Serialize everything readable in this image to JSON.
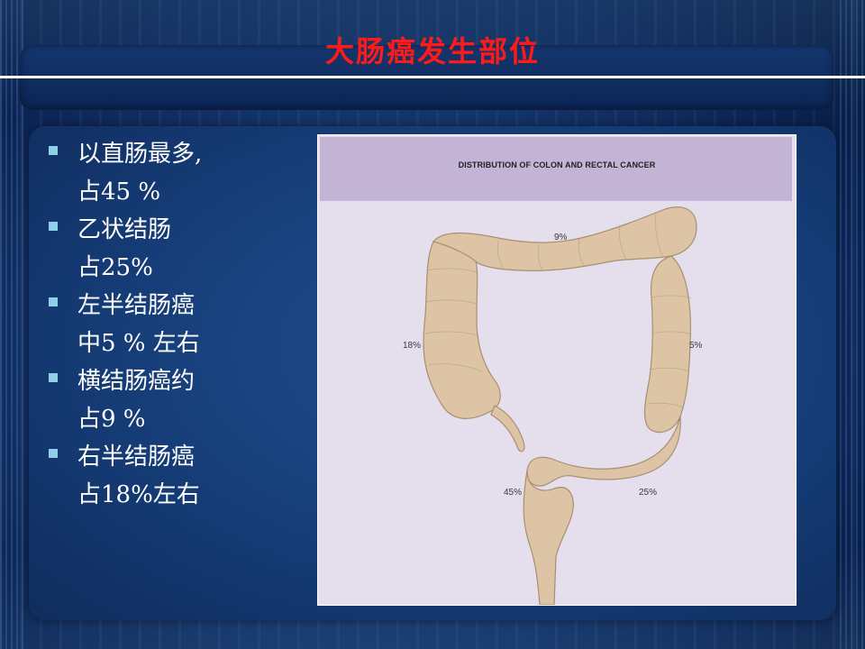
{
  "slide": {
    "title": "大肠癌发生部位"
  },
  "bullets": [
    {
      "line1": "以直肠最多,",
      "line2": "占45 %"
    },
    {
      "line1": "乙状结肠",
      "line2": "占25%"
    },
    {
      "line1": "左半结肠癌",
      "line2": "中5 % 左右"
    },
    {
      "line1": "横结肠癌约",
      "line2": "占9 %"
    },
    {
      "line1": "右半结肠癌",
      "line2": "占18%左右"
    }
  ],
  "figure": {
    "title": "DISTRIBUTION OF COLON AND RECTAL CANCER",
    "labels": {
      "transverse": "9%",
      "ascending": "18%",
      "descending": "5%",
      "rectum": "45%",
      "sigmoid": "25%"
    },
    "colors": {
      "header": "#c3b4d5",
      "background": "#e4deed",
      "colon": "#dcc4a4",
      "colon_outline": "#a98f72",
      "title_text": "#ff1a1a",
      "bullet_marker": "#8fd0e8"
    }
  }
}
